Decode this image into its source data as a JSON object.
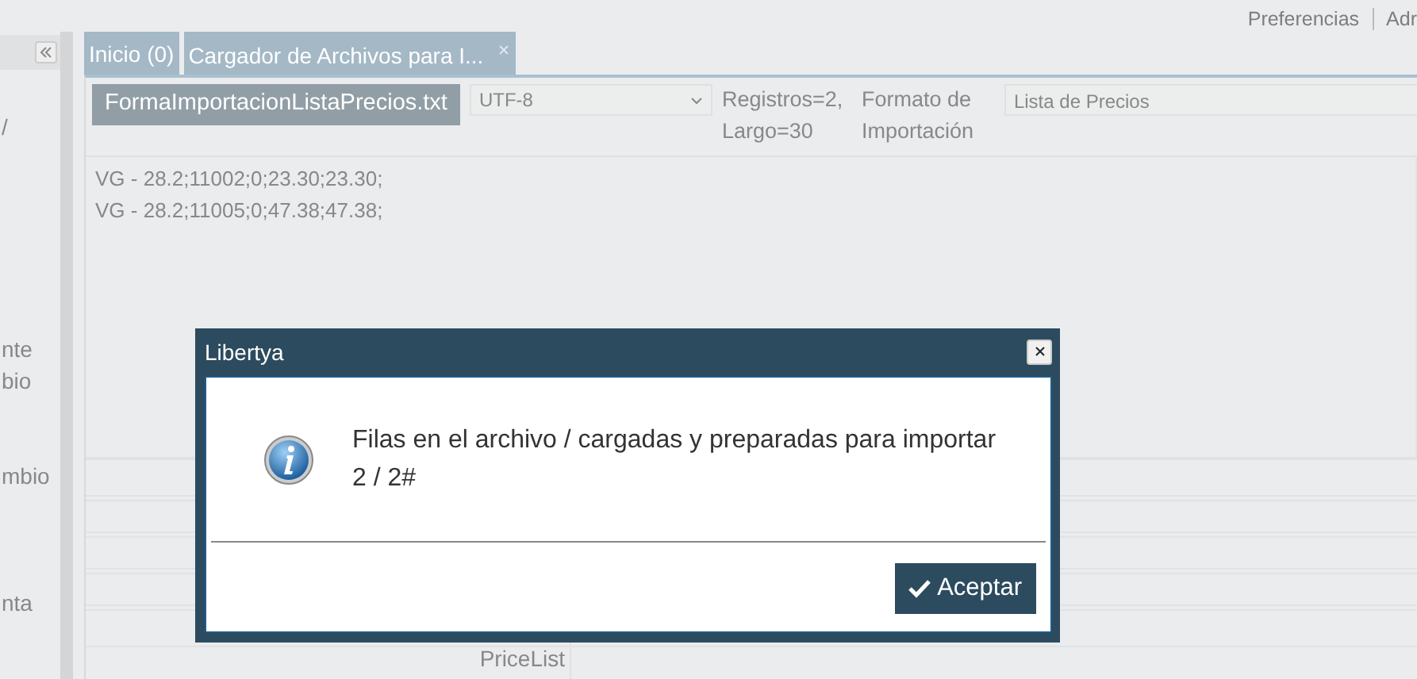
{
  "top_links": [
    "Preferencias",
    "Adr"
  ],
  "sidebar": {
    "fragments": [
      "/",
      "nte",
      "bio",
      "mbio",
      "nta"
    ]
  },
  "tabs": [
    {
      "label": "Inicio (0)",
      "selected": false,
      "closable": false
    },
    {
      "label": "Cargador de Archivos para I...",
      "selected": true,
      "closable": true
    }
  ],
  "toolbar": {
    "file_button": "FormaImportacionListaPrecios.txt",
    "encoding": "UTF-8",
    "records": "Registros=2, Largo=30",
    "format_label": "Formato de Importación",
    "format_value": "Lista de Precios"
  },
  "file_lines": [
    "VG - 28.2;11002;0;23.30;23.30;",
    "VG - 28.2;11005;0;47.38;47.38;"
  ],
  "form": {
    "label": "PriceList"
  },
  "dialog": {
    "title": "Libertya",
    "message": "Filas en el archivo / cargadas y preparadas para importar\n2 / 2#",
    "button": "Aceptar"
  }
}
